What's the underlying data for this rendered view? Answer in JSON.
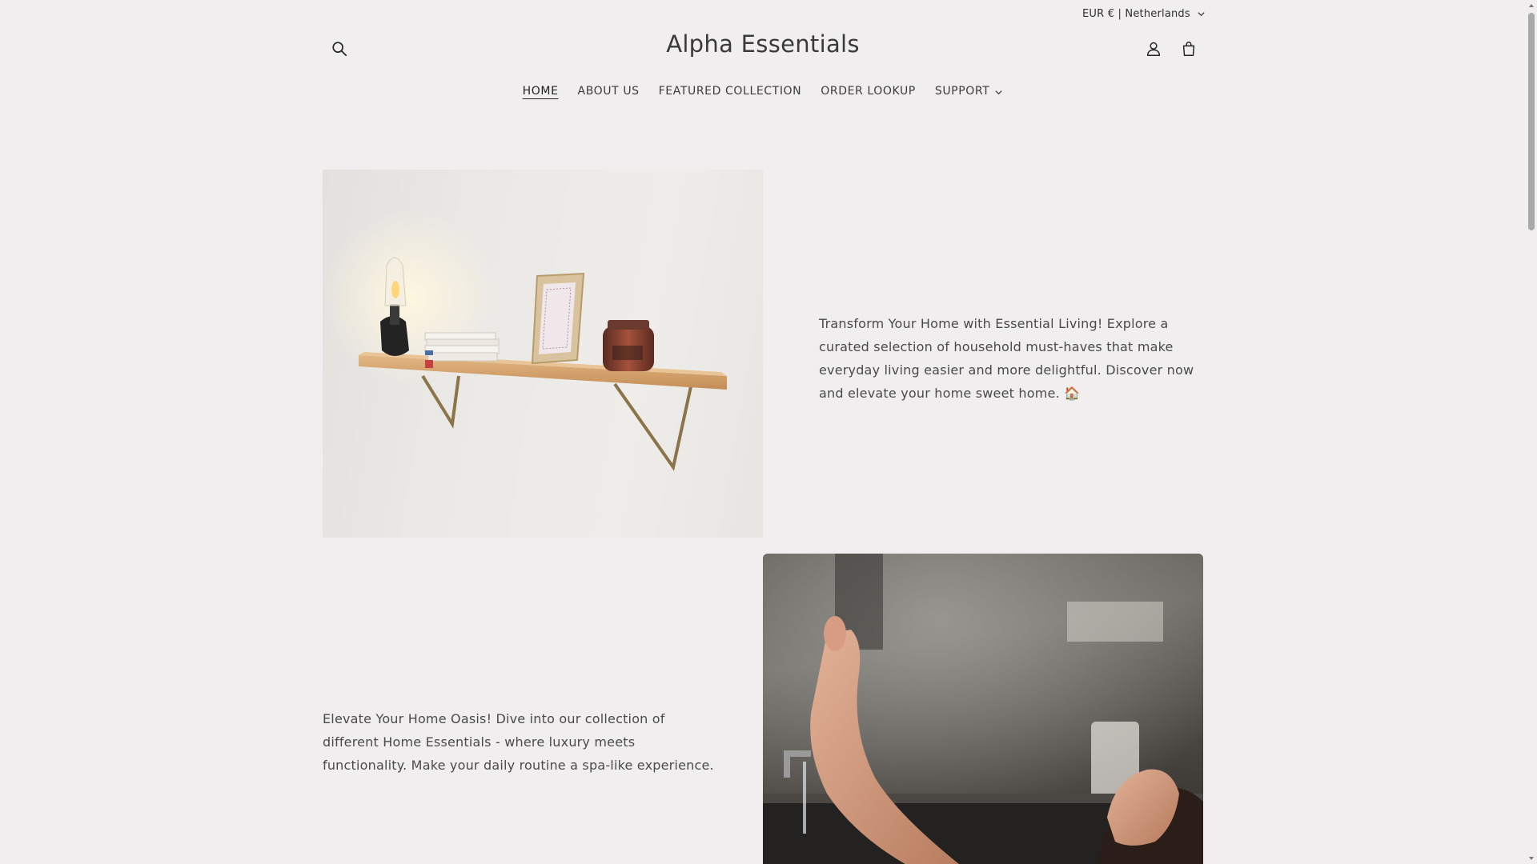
{
  "header": {
    "currency_label": "EUR € | Netherlands",
    "logo": "Alpha Essentials",
    "icons": {
      "search": "search-icon",
      "account": "account-icon",
      "cart": "cart-icon"
    }
  },
  "nav": {
    "items": [
      {
        "label": "HOME",
        "active": true
      },
      {
        "label": "ABOUT US"
      },
      {
        "label": "FEATURED COLLECTION"
      },
      {
        "label": "ORDER LOOKUP"
      },
      {
        "label": "SUPPORT",
        "has_dropdown": true
      }
    ]
  },
  "sections": [
    {
      "image": "wall-shelf-with-lamp-books-frame-candle",
      "text": "Transform Your Home with Essential Living! Explore a curated selection of household must-haves that make everyday living easier and more delightful. Discover now and elevate your home sweet home. 🏠"
    },
    {
      "image": "woman-relaxing-in-bath",
      "text": "Elevate Your Home Oasis! Dive into our collection of different Home Essentials - where luxury meets functionality. Make your daily routine a spa-like experience."
    }
  ],
  "colors": {
    "background": "#f0eeee",
    "text": "#3b3b3b"
  }
}
